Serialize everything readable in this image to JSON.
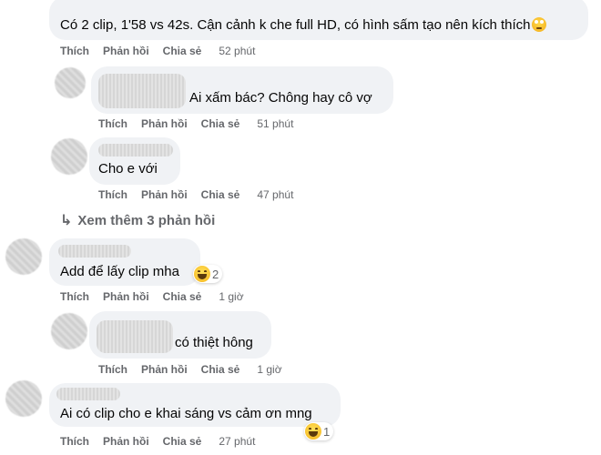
{
  "comments": [
    {
      "text": "Có 2 clip, 1'58 vs 42s. Cận cảnh k che full HD, có hình sấm tạo nên kích thích",
      "emoji": "rolling-eyes-emoji",
      "like": "Thích",
      "reply": "Phản hồi",
      "share": "Chia sẻ",
      "time": "52 phút"
    },
    {
      "text": "Ai xấm bác? Chông hay cô vợ",
      "like": "Thích",
      "reply": "Phản hồi",
      "share": "Chia sẻ",
      "time": "51 phút"
    },
    {
      "text": "Cho e với",
      "like": "Thích",
      "reply": "Phản hồi",
      "share": "Chia sẻ",
      "time": "47 phút"
    },
    {
      "text": "Add để lấy clip mha",
      "like": "Thích",
      "reply": "Phản hồi",
      "share": "Chia sẻ",
      "time": "1 giờ",
      "reaction_count": "2"
    },
    {
      "text": "có thiệt hông",
      "like": "Thích",
      "reply": "Phản hồi",
      "share": "Chia sẻ",
      "time": "1 giờ"
    },
    {
      "text": "Ai có clip cho e khai sáng vs cảm ơn mng",
      "like": "Thích",
      "reply": "Phản hồi",
      "share": "Chia sẻ",
      "time": "27 phút",
      "reaction_count": "1"
    }
  ],
  "see_more": "Xem thêm 3 phản hồi",
  "colors": {
    "bubble": "#f0f2f5",
    "meta": "#65676b",
    "text": "#050505"
  }
}
